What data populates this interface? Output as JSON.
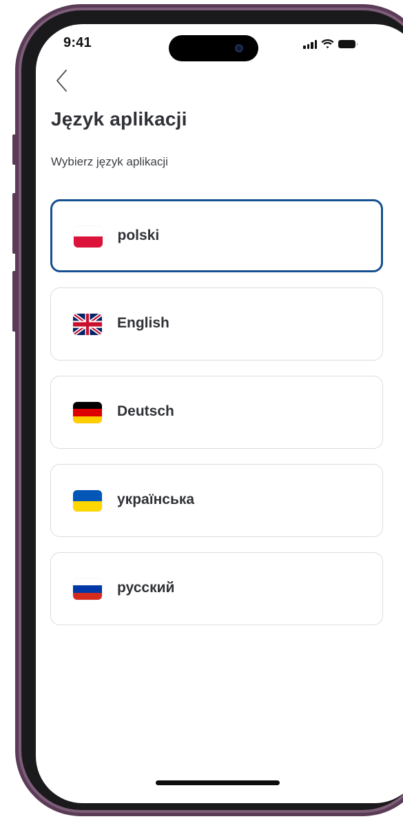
{
  "status_bar": {
    "time": "9:41"
  },
  "header": {
    "back_icon": "chevron-left-icon",
    "title": "Język aplikacji",
    "subtitle": "Wybierz język aplikacji"
  },
  "languages": [
    {
      "label": "polski",
      "flag_icon": "flag-poland-icon",
      "selected": true,
      "flag_colors": [
        "#ffffff",
        "#dc143c"
      ]
    },
    {
      "label": "English",
      "flag_icon": "flag-uk-icon",
      "selected": false,
      "flag_colors": [
        "#012169",
        "#ffffff",
        "#c8102e"
      ]
    },
    {
      "label": "Deutsch",
      "flag_icon": "flag-germany-icon",
      "selected": false,
      "flag_colors": [
        "#000000",
        "#dd0000",
        "#ffce00"
      ]
    },
    {
      "label": "українська",
      "flag_icon": "flag-ukraine-icon",
      "selected": false,
      "flag_colors": [
        "#0057b7",
        "#ffd700"
      ]
    },
    {
      "label": "русский",
      "flag_icon": "flag-russia-icon",
      "selected": false,
      "flag_colors": [
        "#ffffff",
        "#0039a6",
        "#d52b1e"
      ]
    }
  ],
  "colors": {
    "selected_border": "#154f8f",
    "card_border": "#d9dbde",
    "text_primary": "#2f3136",
    "phone_frame": "#5a3c57"
  }
}
